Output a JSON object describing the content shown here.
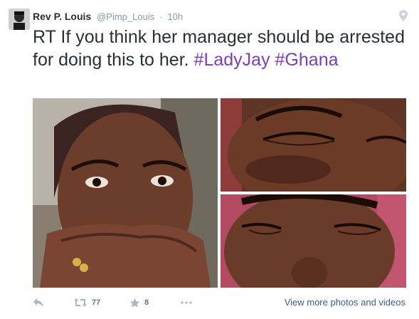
{
  "tweet": {
    "author_name": "Rev P. Louis",
    "author_handle": "@Pimp_Louis",
    "separator": "·",
    "timestamp": "10h",
    "text_plain": "RT If you think her manager should be arrested for doing this to her.",
    "hashtags": [
      "#LadyJay",
      "#Ghana"
    ],
    "hashtag_color": "#7c3eb8",
    "icons": {
      "location": "map-pin-icon",
      "reply": "reply-icon",
      "retweet": "retweet-icon",
      "favorite": "star-icon",
      "more": "more-dots-icon"
    }
  },
  "actions": {
    "retweet_count": "77",
    "favorite_count": "8",
    "view_more_label": "View more photos and videos"
  },
  "colors": {
    "text": "#292f33",
    "muted": "#8899a6",
    "link": "#3b5c8e"
  }
}
